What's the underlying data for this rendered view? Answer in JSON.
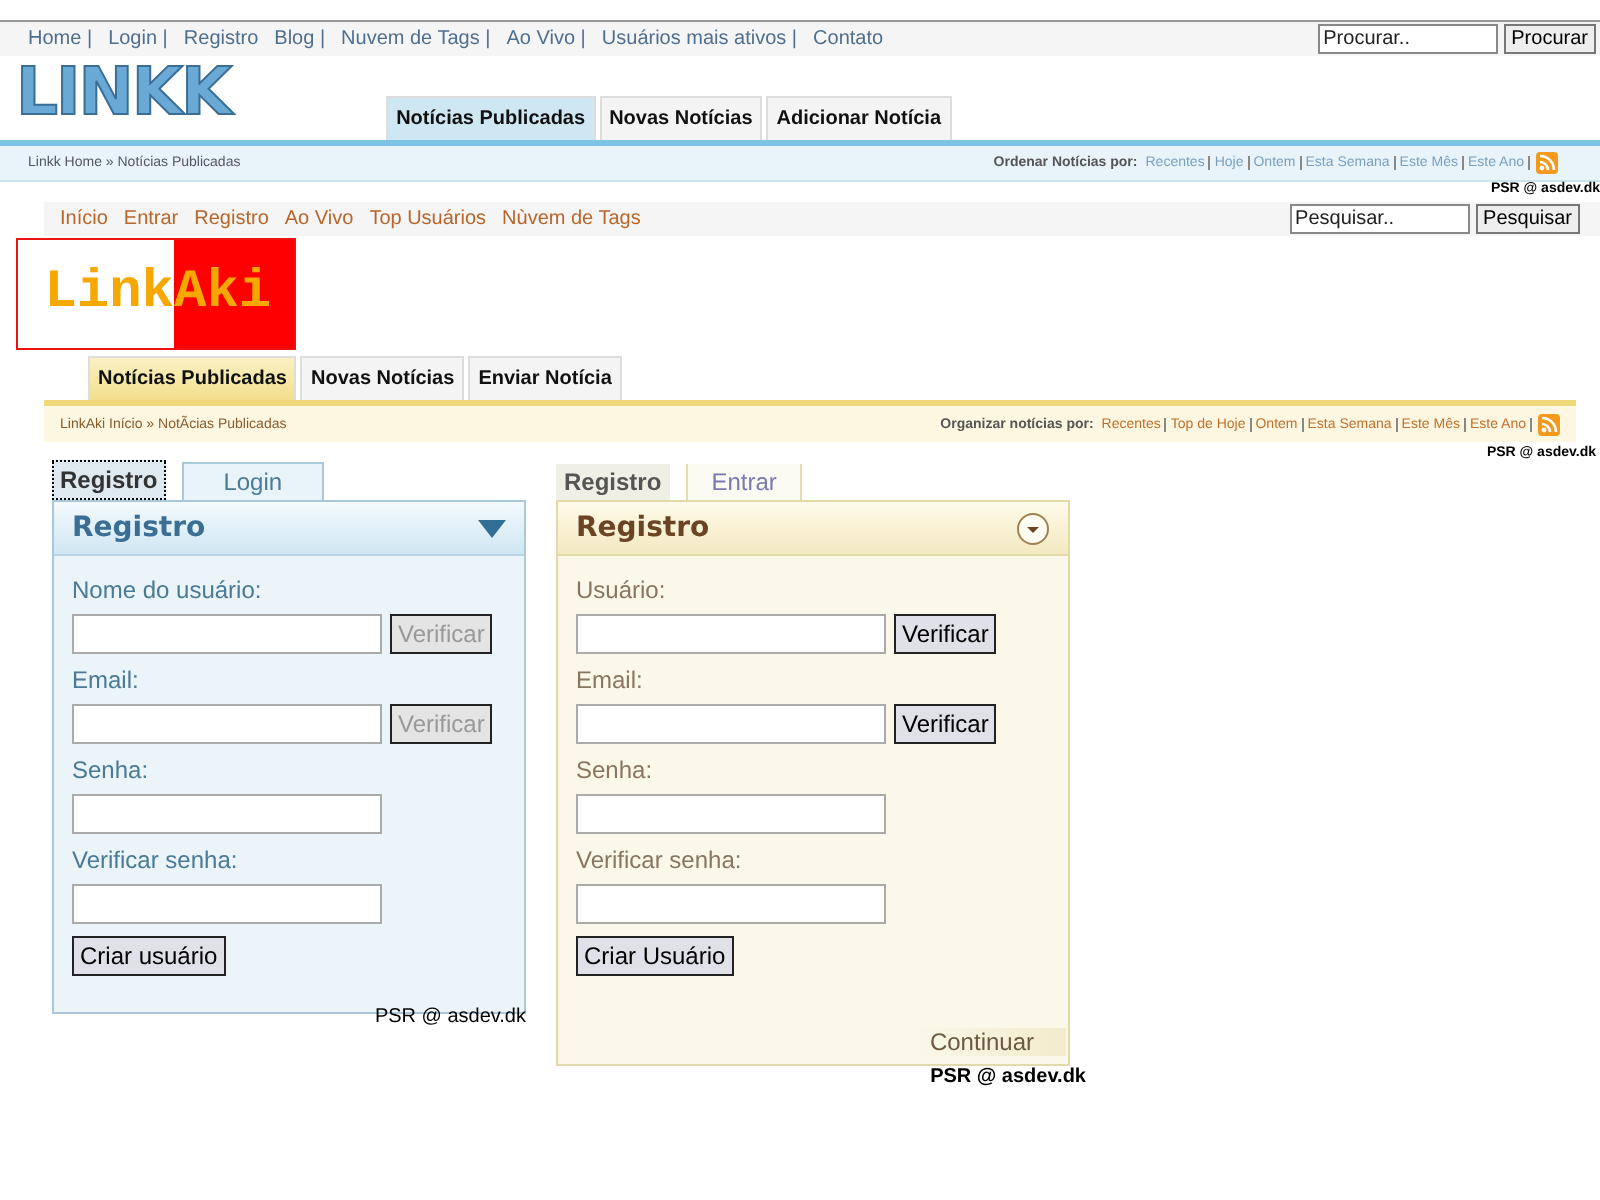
{
  "sites": [
    {
      "kind": "linkk",
      "nav": [
        "Home |",
        "Login |",
        "Registro",
        "Blog |",
        "Nuvem de Tags |",
        "Ao Vivo |",
        "Usuários mais ativos |",
        "Contato"
      ],
      "search": {
        "placeholder": "Procurar..",
        "button": "Procurar"
      },
      "logo": [
        "LINKK"
      ],
      "tabs": [
        {
          "label": "Notícias Publicadas",
          "selected": true
        },
        {
          "label": "Novas Notícias",
          "selected": false
        },
        {
          "label": "Adicionar Notícia",
          "selected": false
        }
      ],
      "breadcrumb": "Linkk Home » Notícias Publicadas",
      "sort": {
        "label": "Ordenar Notícias por:",
        "options": [
          "Recentes",
          "Hoje",
          "Ontem",
          "Esta Semana",
          "Este Mês",
          "Este Ano"
        ]
      },
      "credit": "PSR @ asdev.dk"
    },
    {
      "kind": "linkaki",
      "nav": [
        "Início",
        "Entrar",
        "Registro",
        "Ao Vivo",
        "Top Usuários",
        "Nùvem de Tags"
      ],
      "search": {
        "placeholder": "Pesquisar..",
        "button": "Pesquisar"
      },
      "logo": [
        "Link",
        "Aki"
      ],
      "tabs": [
        {
          "label": "Notícias Publicadas",
          "selected": true
        },
        {
          "label": "Novas Notícias",
          "selected": false
        },
        {
          "label": "Enviar Notícia",
          "selected": false
        }
      ],
      "breadcrumb": "LinkAki Início » NotÃcias Publicadas",
      "sort": {
        "label": "Organizar notícias por:",
        "options": [
          "Recentes",
          "Top de Hoje",
          "Ontem",
          "Esta Semana",
          "Este Mês",
          "Este Ano"
        ]
      },
      "credit": "PSR @ asdev.dk"
    }
  ],
  "panels": [
    {
      "kind": "blue",
      "tabs": [
        {
          "label": "Registro",
          "selected": true
        },
        {
          "label": "Login",
          "selected": false
        }
      ],
      "title": "Registro",
      "fields": [
        {
          "label": "Nome do usuário:",
          "button": {
            "label": "Verificar",
            "disabled": true
          }
        },
        {
          "label": "Email:",
          "button": {
            "label": "Verificar",
            "disabled": true
          }
        },
        {
          "label": "Senha:"
        },
        {
          "label": "Verificar senha:"
        }
      ],
      "submit": "Criar usuário",
      "credit": "PSR @ asdev.dk"
    },
    {
      "kind": "beige",
      "tabs": [
        {
          "label": "Registro",
          "selected": true
        },
        {
          "label": "Entrar",
          "selected": false
        }
      ],
      "title": "Registro",
      "fields": [
        {
          "label": "Usuário:",
          "button": {
            "label": "Verificar",
            "disabled": false
          }
        },
        {
          "label": "Email:",
          "button": {
            "label": "Verificar",
            "disabled": false
          }
        },
        {
          "label": "Senha:"
        },
        {
          "label": "Verificar senha:"
        }
      ],
      "submit": "Criar Usuário",
      "continue": "Continuar",
      "credit": "PSR @ asdev.dk"
    }
  ]
}
